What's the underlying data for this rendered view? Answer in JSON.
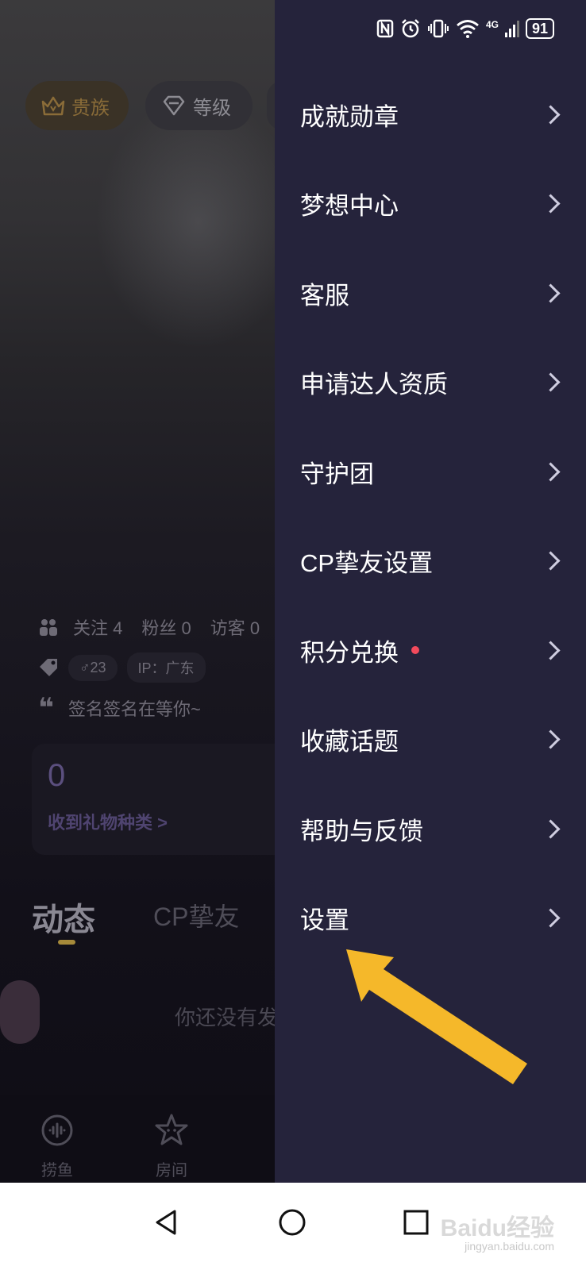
{
  "background_profile": {
    "chips": {
      "noble": "贵族",
      "level": "等级"
    },
    "stats": {
      "follow": "关注 4",
      "fans": "粉丝 0",
      "visitors": "访客 0"
    },
    "age_badge": "♂23",
    "ip_badge": "IP：广东",
    "signature": "签名签名在等你~",
    "gift_card": {
      "count": "0",
      "label": "收到礼物种类 >"
    },
    "tabs": {
      "active": "动态",
      "other": "CP挚友"
    },
    "empty_text": "你还没有发",
    "bottom_nav": [
      {
        "label": "捞鱼",
        "icon": "wave-bubble-icon"
      },
      {
        "label": "房间",
        "icon": "star-face-icon"
      }
    ]
  },
  "status_bar": {
    "battery": "91",
    "network": "4G"
  },
  "drawer": {
    "items": [
      {
        "label": "成就勋章"
      },
      {
        "label": "梦想中心"
      },
      {
        "label": "客服"
      },
      {
        "label": "申请达人资质"
      },
      {
        "label": "守护团"
      },
      {
        "label": "CP挚友设置"
      },
      {
        "label": "积分兑换",
        "badge": "red-dot"
      },
      {
        "label": "收藏话题"
      },
      {
        "label": "帮助与反馈"
      },
      {
        "label": "设置"
      }
    ]
  },
  "annotation": {
    "arrow_color": "#F5B82A",
    "points_to": "设置"
  },
  "watermark": {
    "text": "Baidu经验",
    "sub": "jingyan.baidu.com"
  },
  "colors": {
    "drawer_bg": "#25233B",
    "accent_gold": "#A68A3A",
    "red_dot": "#F24A5C"
  }
}
